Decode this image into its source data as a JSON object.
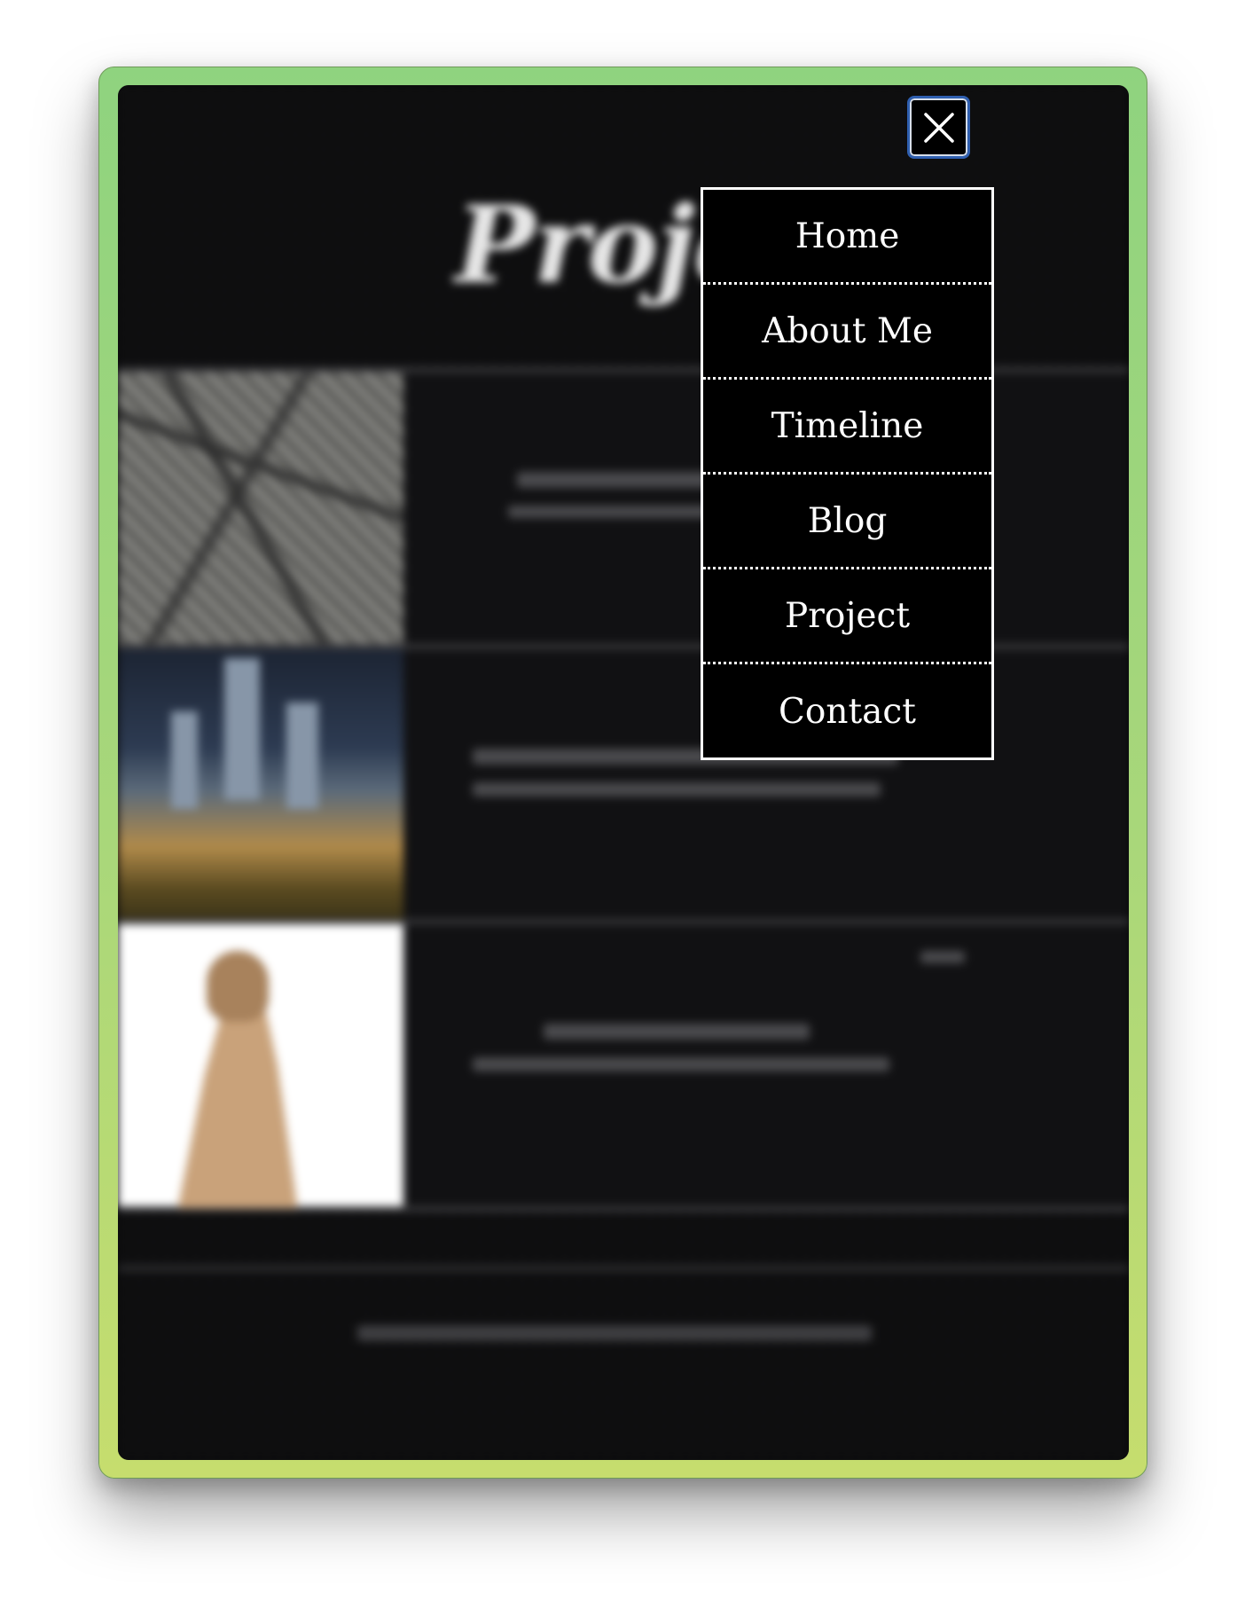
{
  "page": {
    "background_title": "Project"
  },
  "close_button": {
    "icon": "close-icon",
    "border_color": "#2f5fb0"
  },
  "nav": {
    "items": [
      {
        "label": "Home"
      },
      {
        "label": "About Me"
      },
      {
        "label": "Timeline"
      },
      {
        "label": "Blog"
      },
      {
        "label": "Project"
      },
      {
        "label": "Contact"
      }
    ]
  },
  "colors": {
    "frame_gradient_top": "#8fd37f",
    "frame_gradient_bottom": "#c6dd6e",
    "menu_background": "#000000",
    "menu_text": "#ffffff"
  }
}
